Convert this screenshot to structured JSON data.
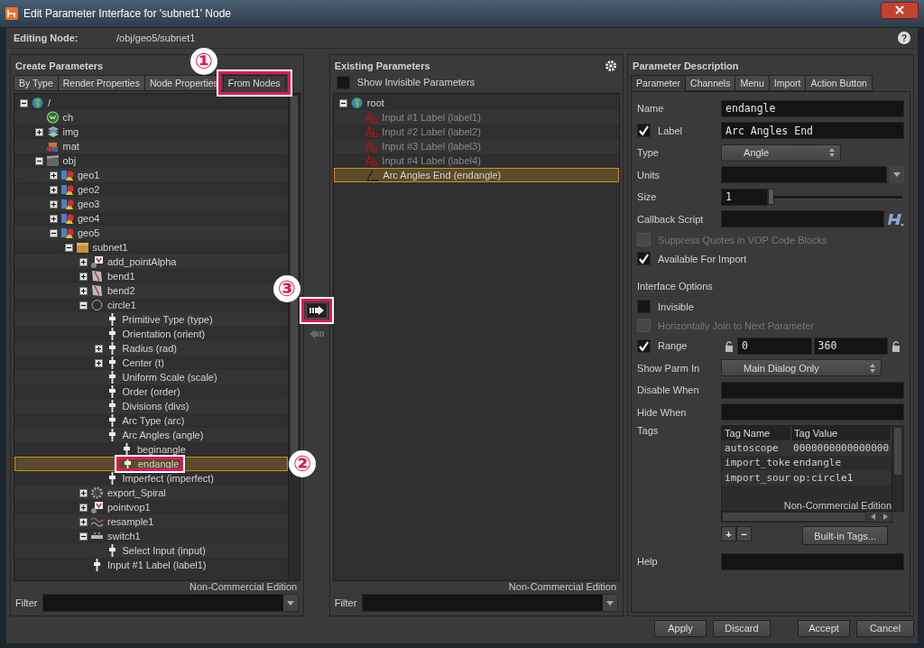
{
  "window": {
    "title": "Edit Parameter Interface for 'subnet1' Node"
  },
  "editing_node": {
    "label": "Editing Node:",
    "path": "/obj/geo5/subnet1",
    "help": "?"
  },
  "create_parameters": {
    "title": "Create Parameters",
    "tabs": [
      {
        "label": "By Type",
        "selected": false
      },
      {
        "label": "Render Properties",
        "selected": false
      },
      {
        "label": "Node Properties",
        "selected": false
      },
      {
        "label": "From Nodes",
        "selected": true,
        "callout": "①"
      }
    ],
    "tree": [
      {
        "label": "/",
        "kind": "globe",
        "expanded": true,
        "selected": false,
        "children": [
          {
            "label": "ch",
            "kind": "disc",
            "selected": false
          },
          {
            "label": "img",
            "kind": "layers",
            "expanded": false,
            "selected": false
          },
          {
            "label": "mat",
            "kind": "cube",
            "selected": false
          },
          {
            "label": "obj",
            "kind": "clapper",
            "expanded": true,
            "selected": false,
            "children": [
              {
                "label": "geo1",
                "kind": "geo",
                "expanded": false,
                "selected": false
              },
              {
                "label": "geo2",
                "kind": "geo",
                "expanded": false,
                "selected": false
              },
              {
                "label": "geo3",
                "kind": "geo",
                "expanded": false,
                "selected": false
              },
              {
                "label": "geo4",
                "kind": "geo",
                "expanded": false,
                "selected": false
              },
              {
                "label": "geo5",
                "kind": "geo",
                "expanded": true,
                "selected": false,
                "children": [
                  {
                    "label": "subnet1",
                    "kind": "box",
                    "expanded": true,
                    "selected": false,
                    "children": [
                      {
                        "label": "add_pointAlpha",
                        "kind": "vop",
                        "expanded": false,
                        "selected": false
                      },
                      {
                        "label": "bend1",
                        "kind": "sheet",
                        "expanded": false,
                        "selected": false
                      },
                      {
                        "label": "bend2",
                        "kind": "sheet",
                        "expanded": false,
                        "selected": false
                      },
                      {
                        "label": "circle1",
                        "kind": "circle",
                        "expanded": true,
                        "selected": false,
                        "children": [
                          {
                            "label": "Primitive Type (type)",
                            "kind": "parm",
                            "selected": false
                          },
                          {
                            "label": "Orientation (orient)",
                            "kind": "parm",
                            "selected": false
                          },
                          {
                            "label": "Radius (rad)",
                            "kind": "parm",
                            "expanded": false,
                            "selected": false
                          },
                          {
                            "label": "Center (t)",
                            "kind": "parm",
                            "expanded": false,
                            "selected": false
                          },
                          {
                            "label": "Uniform Scale (scale)",
                            "kind": "parm",
                            "selected": false
                          },
                          {
                            "label": "Order (order)",
                            "kind": "parm",
                            "selected": false
                          },
                          {
                            "label": "Divisions (divs)",
                            "kind": "parm",
                            "selected": false
                          },
                          {
                            "label": "Arc Type (arc)",
                            "kind": "parm",
                            "selected": false
                          },
                          {
                            "label": "Arc Angles (angle)",
                            "kind": "parm",
                            "selected": false,
                            "children": [
                              {
                                "label": "beginangle",
                                "kind": "parm",
                                "selected": false
                              },
                              {
                                "label": "endangle",
                                "kind": "parm",
                                "selected": true,
                                "callout": "②"
                              }
                            ]
                          },
                          {
                            "label": "Imperfect (imperfect)",
                            "kind": "parm",
                            "selected": false
                          }
                        ]
                      },
                      {
                        "label": "export_Spiral",
                        "kind": "gear",
                        "expanded": false,
                        "selected": false
                      },
                      {
                        "label": "pointvop1",
                        "kind": "vop",
                        "expanded": false,
                        "selected": false
                      },
                      {
                        "label": "resample1",
                        "kind": "wave",
                        "expanded": false,
                        "selected": false
                      },
                      {
                        "label": "switch1",
                        "kind": "switch",
                        "expanded": true,
                        "selected": false,
                        "children": [
                          {
                            "label": "Select Input (input)",
                            "kind": "parm",
                            "selected": false
                          }
                        ]
                      },
                      {
                        "label": "Input #1 Label (label1)",
                        "kind": "parm",
                        "selected": false
                      }
                    ]
                  }
                ]
              }
            ]
          }
        ]
      }
    ],
    "watermark": "Non-Commercial Edition",
    "filter": {
      "label": "Filter"
    }
  },
  "transfer": {
    "callout": "③"
  },
  "existing_parameters": {
    "title": "Existing Parameters",
    "show_invisible": {
      "label": "Show Invisible Parameters",
      "checked": false
    },
    "tree": [
      {
        "label": "root",
        "kind": "globe",
        "expanded": true,
        "selected": false,
        "children": [
          {
            "label": "Input #1 Label (label1)",
            "kind": "text",
            "disabled": true,
            "selected": false
          },
          {
            "label": "Input #2 Label (label2)",
            "kind": "text",
            "disabled": true,
            "selected": false
          },
          {
            "label": "Input #3 Label (label3)",
            "kind": "text",
            "disabled": true,
            "selected": false
          },
          {
            "label": "Input #4 Label (label4)",
            "kind": "text",
            "disabled": true,
            "selected": false
          },
          {
            "label": "Arc Angles End (endangle)",
            "kind": "angle",
            "disabled": false,
            "selected": true
          }
        ]
      }
    ],
    "watermark": "Non-Commercial Edition",
    "filter": {
      "label": "Filter"
    }
  },
  "parameter_description": {
    "title": "Parameter Description",
    "tabs": [
      {
        "label": "Parameter",
        "selected": true
      },
      {
        "label": "Channels",
        "selected": false
      },
      {
        "label": "Menu",
        "selected": false
      },
      {
        "label": "Import",
        "selected": false
      },
      {
        "label": "Action Button",
        "selected": false
      }
    ],
    "rows": [
      {
        "kind": "field",
        "label": "Name",
        "value": "endangle"
      },
      {
        "kind": "check-field",
        "label": "Label",
        "checked": true,
        "value": "Arc Angles End"
      },
      {
        "kind": "menu",
        "label": "Type",
        "value": "Angle"
      },
      {
        "kind": "combo",
        "label": "Units"
      },
      {
        "kind": "slider",
        "label": "Size",
        "value": "1",
        "level": 0
      },
      {
        "kind": "script",
        "label": "Callback Script"
      },
      {
        "kind": "checkbox",
        "label": "Suppress Quotes in VOP Code Blocks",
        "checked": false,
        "disabled": true
      },
      {
        "kind": "checkbox",
        "label": "Available For Import",
        "checked": true,
        "disabled": false
      },
      {
        "kind": "section",
        "label": "Interface Options"
      },
      {
        "kind": "checkbox",
        "label": "Invisible",
        "checked": false,
        "disabled": false
      },
      {
        "kind": "checkbox",
        "label": "Horizontally Join to Next Parameter",
        "checked": false,
        "disabled": true
      },
      {
        "kind": "range",
        "label": "Range",
        "checked": true,
        "min": "0",
        "max": "360"
      },
      {
        "kind": "menu",
        "label": "Show Parm In",
        "value": "Main Dialog Only"
      },
      {
        "kind": "field",
        "label": "Disable When"
      },
      {
        "kind": "field",
        "label": "Hide When"
      },
      {
        "kind": "tags",
        "label": "Tags",
        "columns": [
          "Tag Name",
          "Tag Value"
        ],
        "rows": [
          [
            "autoscope",
            "0000000000000000"
          ],
          [
            "import_toke",
            "endangle"
          ],
          [
            "import_sour",
            "op:circle1"
          ]
        ],
        "watermark": "Non-Commercial Edition",
        "add": "+",
        "remove": "−",
        "builtin": "Built-in Tags..."
      },
      {
        "kind": "field",
        "label": "Help"
      }
    ]
  },
  "button_groups": [
    [
      "Apply",
      "Discard"
    ],
    [
      "Accept",
      "Cancel"
    ]
  ]
}
